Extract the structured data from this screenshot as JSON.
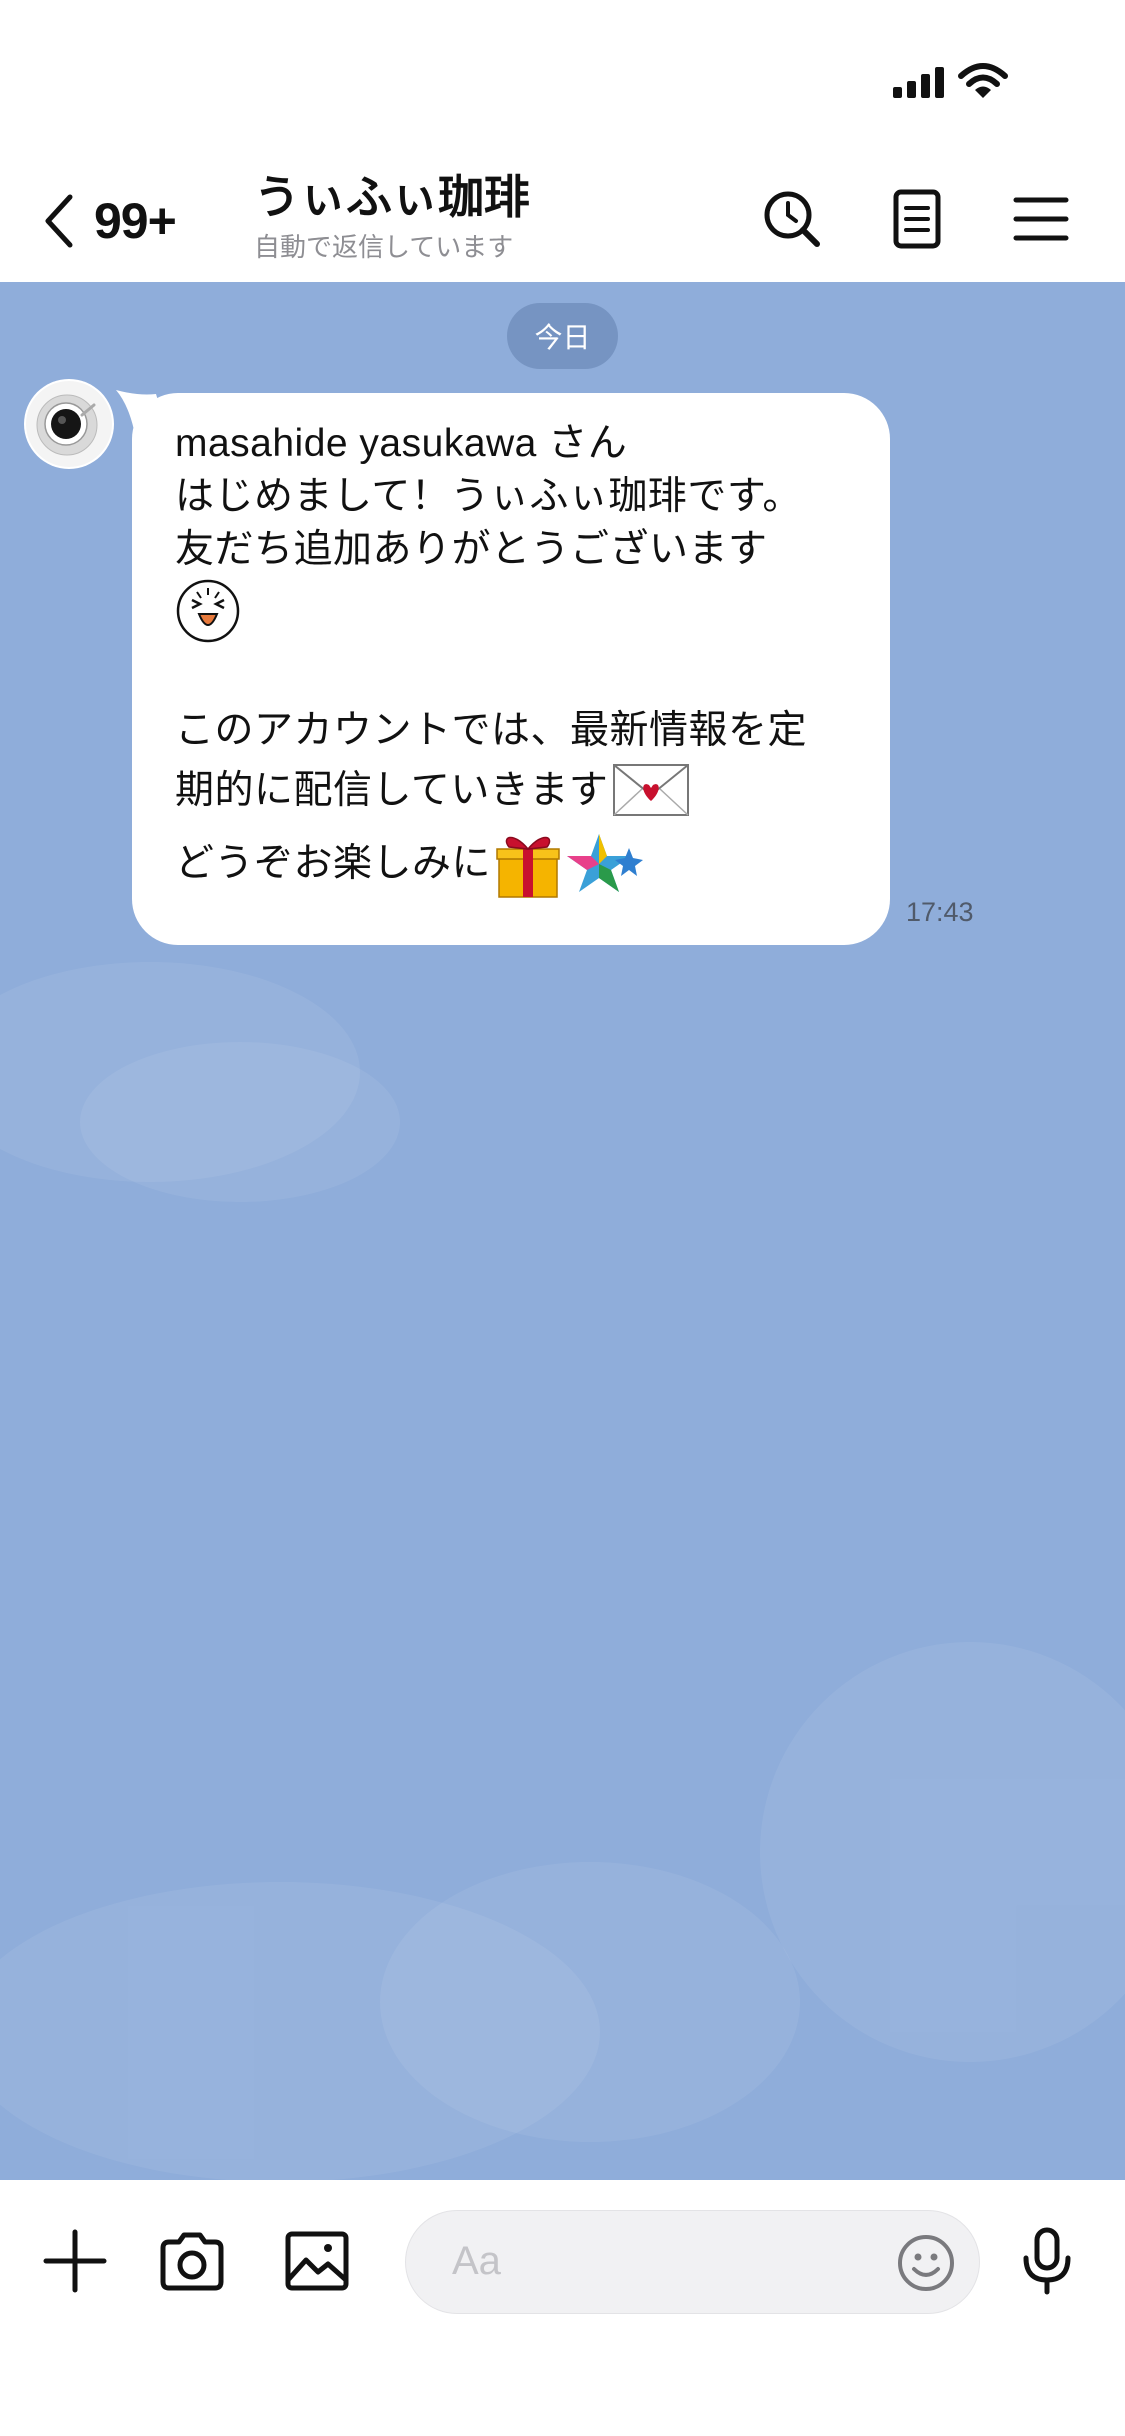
{
  "status_bar": {
    "signal_icon": "cellular-signal-icon",
    "wifi_icon": "wifi-icon"
  },
  "header": {
    "back_icon": "chevron-left-icon",
    "unread_count": "99+",
    "title": "うぃふぃ珈琲",
    "subtitle": "自動で返信しています",
    "search_icon": "search-icon",
    "notes_icon": "notes-icon",
    "menu_icon": "hamburger-menu-icon"
  },
  "chat": {
    "background_color": "#8fadda",
    "date_separator": "今日",
    "messages": [
      {
        "sender_avatar": "coffee-cup-avatar",
        "lines": [
          "masahide yasukawa さん",
          "はじめまして！うぃふぃ珈琲です。",
          "友だち追加ありがとうございます",
          "このアカウントでは、最新情報を定",
          "期的に配信していきます",
          "どうぞお楽しみに"
        ],
        "emojis": [
          "laughing-face-emoji",
          "love-letter-emoji",
          "gift-emoji",
          "shooting-star-emoji"
        ],
        "time": "17:43"
      }
    ]
  },
  "input_bar": {
    "plus_icon": "plus-icon",
    "camera_icon": "camera-icon",
    "image_icon": "image-icon",
    "placeholder": "Aa",
    "emoji_icon": "smiley-icon",
    "mic_icon": "microphone-icon"
  }
}
